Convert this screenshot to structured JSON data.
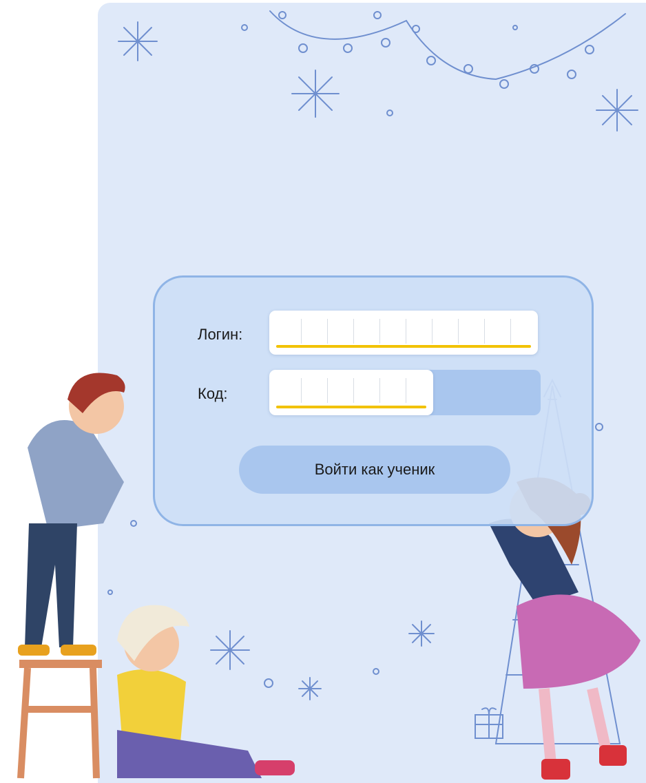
{
  "form": {
    "login_label": "Логин:",
    "code_label": "Код:",
    "submit_label": "Войти как ученик"
  },
  "fields": {
    "login": {
      "value": "",
      "cells": 10
    },
    "code": {
      "value": "",
      "cells": 6
    }
  },
  "illustration": {
    "description_icons": [
      "snowflake-icon",
      "garland-icon",
      "christmas-tree-icon",
      "gift-icon"
    ],
    "colors": {
      "panel": "#dfe9f9",
      "card": "#cddef6",
      "accent": "#f2c200",
      "button": "#a9c6ee"
    }
  }
}
